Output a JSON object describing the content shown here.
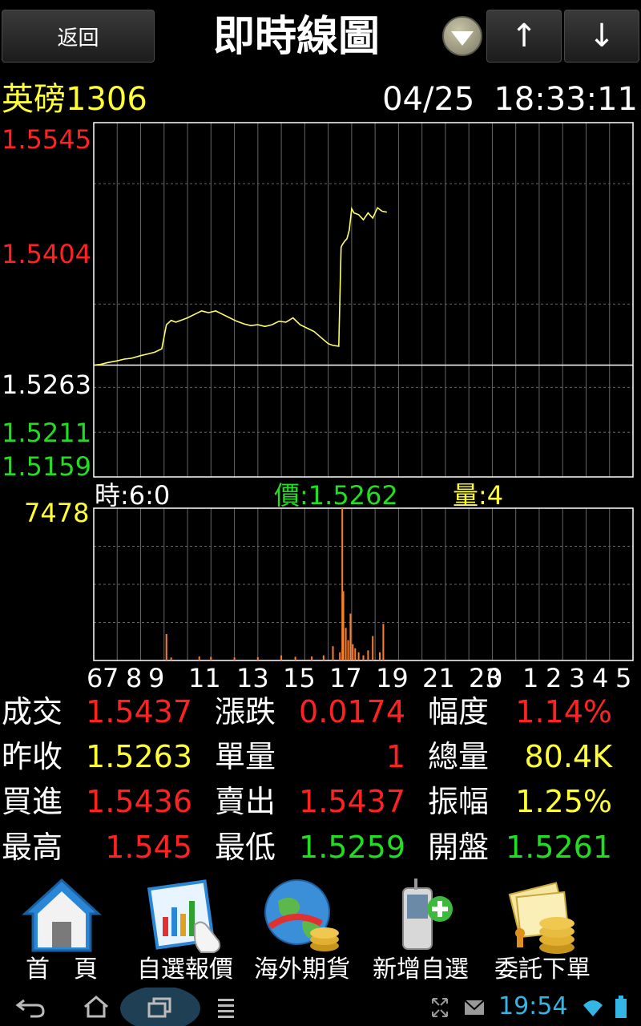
{
  "header": {
    "back_label": "返回",
    "title": "即時線圖",
    "up_label": "↑",
    "down_label": "↓"
  },
  "info": {
    "symbol": "英磅1306",
    "date": "04/25",
    "time": "18:33:11"
  },
  "price_axis": {
    "top": "1.5545",
    "mid_high": "1.5404",
    "ref": "1.5263",
    "low1": "1.5211",
    "low2": "1.5159"
  },
  "cursor": {
    "time_text": "時:6:0",
    "price_text": "價:1.5262",
    "vol_label": "量",
    "vol_value": ":4"
  },
  "volume_axis": {
    "max": "7478"
  },
  "x_labels": [
    "6",
    "7",
    "8",
    "9",
    "11",
    "13",
    "15",
    "17",
    "19",
    "21",
    "23",
    "0",
    "1",
    "2",
    "3",
    "4",
    "5"
  ],
  "stats": [
    {
      "label": "成交",
      "value": "1.5437",
      "color": "red"
    },
    {
      "label": "漲跌",
      "value": "0.0174",
      "color": "red"
    },
    {
      "label": "幅度",
      "value": "1.14%",
      "color": "red"
    },
    {
      "label": "昨收",
      "value": "1.5263",
      "color": "yellow"
    },
    {
      "label": "單量",
      "value": "1",
      "color": "red"
    },
    {
      "label": "總量",
      "value": "80.4K",
      "color": "yellow"
    },
    {
      "label": "買進",
      "value": "1.5436",
      "color": "red"
    },
    {
      "label": "賣出",
      "value": "1.5437",
      "color": "red"
    },
    {
      "label": "振幅",
      "value": "1.25%",
      "color": "yellow"
    },
    {
      "label": "最高",
      "value": "1.545",
      "color": "red"
    },
    {
      "label": "最低",
      "value": "1.5259",
      "color": "green"
    },
    {
      "label": "開盤",
      "value": "1.5261",
      "color": "green"
    }
  ],
  "nav": [
    {
      "label": "首　頁",
      "icon": "home-icon"
    },
    {
      "label": "自選報價",
      "icon": "watchlist-chart-icon"
    },
    {
      "label": "海外期貨",
      "icon": "globe-coins-icon"
    },
    {
      "label": "新增自選",
      "icon": "phone-add-icon"
    },
    {
      "label": "委託下單",
      "icon": "order-coins-icon"
    }
  ],
  "system": {
    "clock": "19:54"
  },
  "colors": {
    "price_line": "#ffff66",
    "volume_bar": "#ff7f27",
    "grid": "#666666",
    "clock": "#33b5e5"
  },
  "chart_data": {
    "type": "line",
    "title": "",
    "price": {
      "x_hours": [
        6.0,
        6.3,
        6.6,
        7.0,
        7.3,
        7.6,
        8.0,
        8.3,
        8.6,
        8.9,
        9.0,
        9.1,
        9.3,
        9.5,
        9.8,
        10.0,
        10.3,
        10.6,
        10.9,
        11.2,
        11.5,
        11.8,
        12.1,
        12.4,
        12.7,
        13.0,
        13.3,
        13.6,
        13.9,
        14.2,
        14.5,
        14.8,
        15.1,
        15.4,
        15.7,
        16.0,
        16.2,
        16.45,
        16.55,
        16.6,
        16.7,
        16.8,
        16.9,
        17.0,
        17.1,
        17.3,
        17.5,
        17.7,
        17.9,
        18.1,
        18.3,
        18.5
      ],
      "y": [
        1.5263,
        1.5264,
        1.5266,
        1.5268,
        1.527,
        1.5271,
        1.5274,
        1.5276,
        1.5278,
        1.5282,
        1.5296,
        1.531,
        1.5315,
        1.5313,
        1.5316,
        1.5318,
        1.5322,
        1.5326,
        1.5324,
        1.5326,
        1.5322,
        1.5318,
        1.5314,
        1.5311,
        1.5309,
        1.531,
        1.5308,
        1.531,
        1.5314,
        1.5313,
        1.5318,
        1.531,
        1.5306,
        1.5302,
        1.5295,
        1.5288,
        1.5286,
        1.5285,
        1.54,
        1.5403,
        1.5407,
        1.541,
        1.542,
        1.5445,
        1.544,
        1.5438,
        1.5432,
        1.544,
        1.5434,
        1.5446,
        1.5442,
        1.5441
      ],
      "reference": 1.5263,
      "ylim": [
        1.5133,
        1.5545
      ]
    },
    "volume": {
      "x_hours": [
        9.1,
        9.3,
        10.5,
        11.0,
        12.0,
        13.0,
        14.0,
        14.6,
        15.3,
        15.8,
        16.2,
        16.5,
        16.6,
        16.65,
        16.75,
        16.85,
        16.95,
        17.05,
        17.15,
        17.3,
        17.5,
        17.7,
        17.9,
        18.2,
        18.35
      ],
      "values": [
        1300,
        150,
        200,
        180,
        150,
        160,
        250,
        180,
        200,
        250,
        700,
        400,
        7478,
        3400,
        1600,
        1000,
        2300,
        800,
        600,
        400,
        250,
        500,
        1200,
        400,
        1800
      ],
      "ylim": [
        0,
        7478
      ]
    },
    "x_range_hours": [
      6,
      29
    ]
  }
}
